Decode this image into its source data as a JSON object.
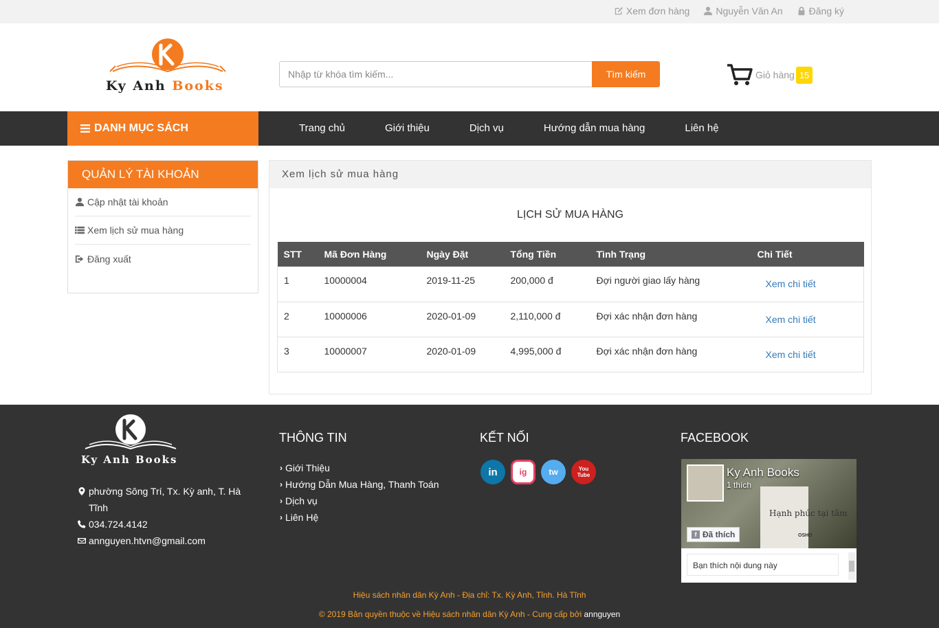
{
  "topbar": {
    "orders_link": "Xem đơn hàng",
    "user_name": "Nguyễn Văn An",
    "register_link": "Đăng ký"
  },
  "header": {
    "logo_text_1": "Ky Anh",
    "logo_text_2": "Books",
    "search_placeholder": "Nhập từ khóa tìm kiếm...",
    "search_button": "Tìm kiếm",
    "cart_label": "Giỏ hàng",
    "cart_count": "15"
  },
  "nav": {
    "category_label": "DANH MỤC SÁCH",
    "links": [
      "Trang chủ",
      "Giới thiệu",
      "Dịch vụ",
      "Hướng dẫn mua hàng",
      "Liên hệ"
    ]
  },
  "sidebar": {
    "title": "QUẢN LÝ TÀI KHOẢN",
    "items": [
      "Cập nhật tài khoản",
      "Xem lịch sử mua hàng",
      "Đăng xuất"
    ]
  },
  "panel": {
    "header": "Xem lịch sử mua hàng",
    "title": "LỊCH SỬ MUA HÀNG",
    "columns": [
      "STT",
      "Mã Đơn Hàng",
      "Ngày Đặt",
      "Tổng Tiền",
      "Tình Trạng",
      "Chi Tiết"
    ],
    "rows": [
      {
        "stt": "1",
        "order_id": "10000004",
        "date": "2019-11-25",
        "total": "200,000 đ",
        "status": "Đợi người giao lấy hàng",
        "detail": "Xem chi tiết"
      },
      {
        "stt": "2",
        "order_id": "10000006",
        "date": "2020-01-09",
        "total": "2,110,000 đ",
        "status": "Đợi xác nhận đơn hàng",
        "detail": "Xem chi tiết"
      },
      {
        "stt": "3",
        "order_id": "10000007",
        "date": "2020-01-09",
        "total": "4,995,000 đ",
        "status": "Đợi xác nhận đơn hàng",
        "detail": "Xem chi tiết"
      }
    ]
  },
  "footer": {
    "logo_text": "Ky Anh Books",
    "address": "phường Sông Trí, Tx. Kỳ anh, T. Hà Tĩnh",
    "phone": "034.724.4142",
    "email": "annguyen.htvn@gmail.com",
    "info_heading": "THÔNG TIN",
    "info_links": [
      "Giới Thiệu",
      "Hướng Dẫn Mua Hàng, Thanh Toán",
      "Dịch vụ",
      "Liên Hệ"
    ],
    "connect_heading": "KẾT NỐI",
    "social": [
      "in",
      "ig",
      "tw",
      "You Tube"
    ],
    "facebook_heading": "FACEBOOK",
    "fb_page_name": "Ky Anh Books",
    "fb_likes": "1 thích",
    "fb_liked_button": "Đã thích",
    "fb_book_title": "Hạnh phúc tại tâm",
    "fb_book_author": "OSHO",
    "fb_post_text": "Bạn thích nội dung này",
    "bottom_line_1": "Hiệu sách nhân dân Kỳ Anh - Địa chỉ: Tx. Kỳ Anh, Tỉnh. Hà Tĩnh",
    "bottom_line_2": "© 2019 Bản quyền thuộc về Hiệu sách nhân dân Kỳ Anh - Cung cấp bởi",
    "bottom_author": "annguyen"
  },
  "colors": {
    "accent": "#f47b20",
    "dark": "#333333",
    "link": "#337ab7",
    "badge": "#ffd700"
  }
}
